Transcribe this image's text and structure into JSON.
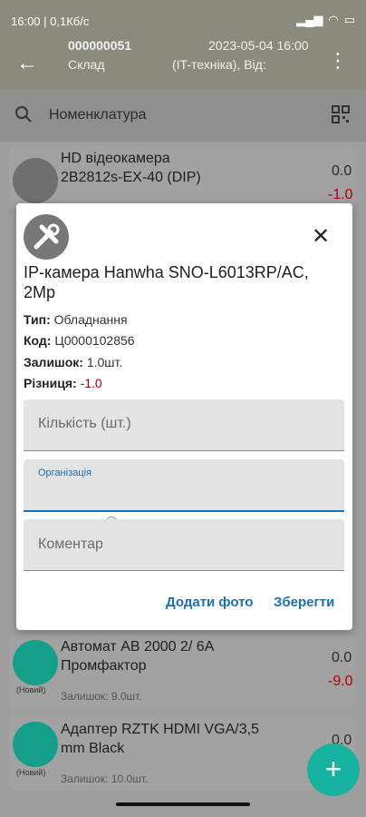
{
  "status_bar": {
    "left_text": "16:00 | 0,1Кб/с",
    "right_text": "▮▮▮ ▮▮▮"
  },
  "header": {
    "doc_number": "000000051",
    "doc_date": "2023-05-04 16:00",
    "warehouse": "Склад",
    "info": "(IT-техніка), Від:"
  },
  "search": {
    "placeholder": "Номенклатура"
  },
  "items": [
    {
      "name_line1": "HD відеокамера",
      "name_line2": "2B2812s-EX-40 (DIP)",
      "qty": "0.0",
      "diff": "-1.0"
    },
    {
      "name_line1": "Автомат АВ 2000 2/ 6А",
      "name_line2": "Промфактор",
      "qty": "0.0",
      "diff": "-9.0",
      "rest": "Залишок: 9.0шт.",
      "tag": "(Новий)"
    },
    {
      "name_line1": "Адаптер RZTK HDMI VGA/3,5",
      "name_line2": "mm Black",
      "qty": "0.0",
      "rest": "Залишок: 10.0шт.",
      "tag": "(Новий)"
    }
  ],
  "dialog": {
    "title": "IP-камера Hanwha SNO-L6013RP/AC, 2Mp",
    "type_label": "Тип:",
    "type_value": "Обладнання",
    "code_label": "Код:",
    "code_value": "Ц0000102856",
    "rest_label": "Залишок:",
    "rest_value": "1.0шт.",
    "diff_label": "Різниця:",
    "diff_value": "-1.0",
    "qty_placeholder": "Кількість (шт.)",
    "org_label": "Організація",
    "comment_placeholder": "Коментар",
    "add_photo": "Додати фото",
    "save": "Зберегти"
  },
  "colors": {
    "accent": "#1b6fb5",
    "fab": "#18b3a0",
    "negative": "#b20000"
  }
}
